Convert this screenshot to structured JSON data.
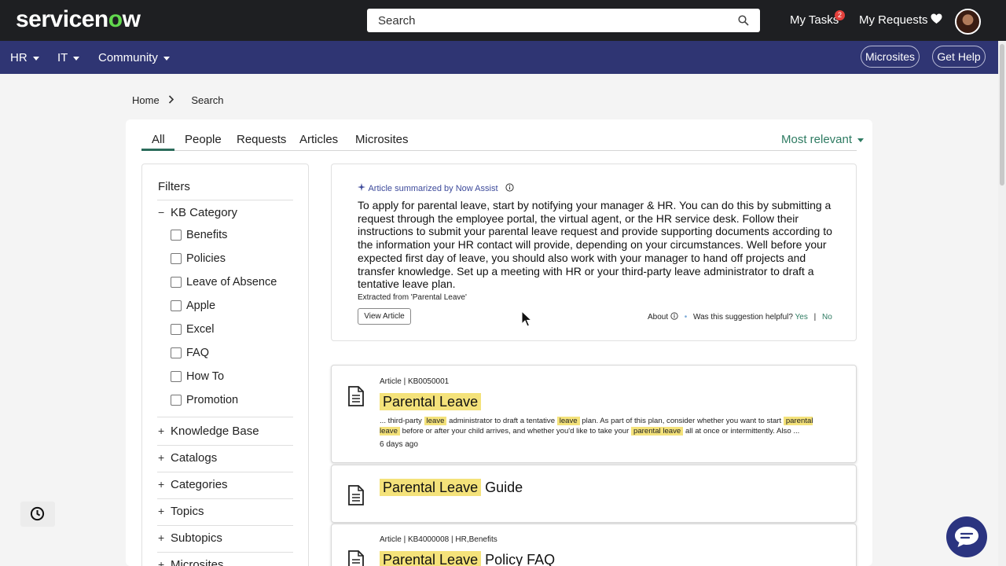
{
  "brand": {
    "logo_pre": "servicen",
    "logo_o": "o",
    "logo_post": "w"
  },
  "header": {
    "search_placeholder": "Search",
    "my_tasks": "My Tasks",
    "tasks_count": "2",
    "my_requests": "My Requests"
  },
  "nav": {
    "items": [
      "HR",
      "IT",
      "Community"
    ],
    "microsites_label": "Microsites",
    "get_help_label": "Get Help"
  },
  "breadcrumb": {
    "home": "Home",
    "current": "Search"
  },
  "tabs": {
    "items": [
      "All",
      "People",
      "Requests",
      "Articles",
      "Microsites"
    ],
    "active": "All",
    "sort_label": "Most relevant"
  },
  "filters": {
    "title": "Filters",
    "kb_category": {
      "label": "KB Category",
      "options": [
        "Benefits",
        "Policies",
        "Leave of Absence",
        "Apple",
        "Excel",
        "FAQ",
        "How To",
        "Promotion"
      ]
    },
    "groups": [
      "Knowledge Base",
      "Catalogs",
      "Categories",
      "Topics",
      "Subtopics",
      "Microsites"
    ]
  },
  "summary": {
    "label": "Article summarized by Now Assist",
    "text": "To apply for parental leave, start by notifying your manager & HR. You can do this by submitting a request through the employee portal, the virtual agent, or the HR service desk. Follow their instructions to submit your parental leave request and provide supporting documents according to the information your HR contact will provide, depending on your circumstances. Well before your expected first day of leave, you should also work with your manager to hand off projects and transfer knowledge. Set up a meeting with HR or your third-party leave administrator to draft a tentative leave plan.",
    "extracted": "Extracted from 'Parental Leave'",
    "view_button": "View Article",
    "about": "About",
    "helpful_q": "Was this suggestion helpful?",
    "yes": "Yes",
    "no": "No"
  },
  "results": [
    {
      "meta_type": "Article",
      "meta_id": "KB0050001",
      "title_hl": "Parental Leave",
      "title_rest": "",
      "snippet": {
        "s1": "... third-party ",
        "h1": "leave",
        "s2": " administrator to draft a tentative ",
        "h2": "leave",
        "s3": " plan. As part of this plan, consider whether you want to start ",
        "h3": "parental leave",
        "s4": " before or after your child arrives, and whether you'd like to take your ",
        "h4": "parental leave",
        "s5": " all at once or intermittently. Also ..."
      },
      "age": "6 days ago"
    },
    {
      "title_hl": "Parental Leave",
      "title_rest": "Guide"
    },
    {
      "meta_type": "Article",
      "meta_id": "KB4000008",
      "meta_extra": "HR,Benefits",
      "title_hl": "Parental Leave",
      "title_rest": "Policy FAQ"
    }
  ],
  "colors": {
    "topbar": "#1e1f22",
    "navbar": "#2f3573",
    "accent_green": "#2e7b62",
    "highlight": "#f4e27a",
    "ai_blue": "#3d4a9b"
  },
  "icons": [
    "search-icon",
    "heart-icon",
    "chevron-right-icon",
    "sparkle-icon",
    "info-icon",
    "document-icon",
    "history-icon",
    "chat-icon"
  ]
}
